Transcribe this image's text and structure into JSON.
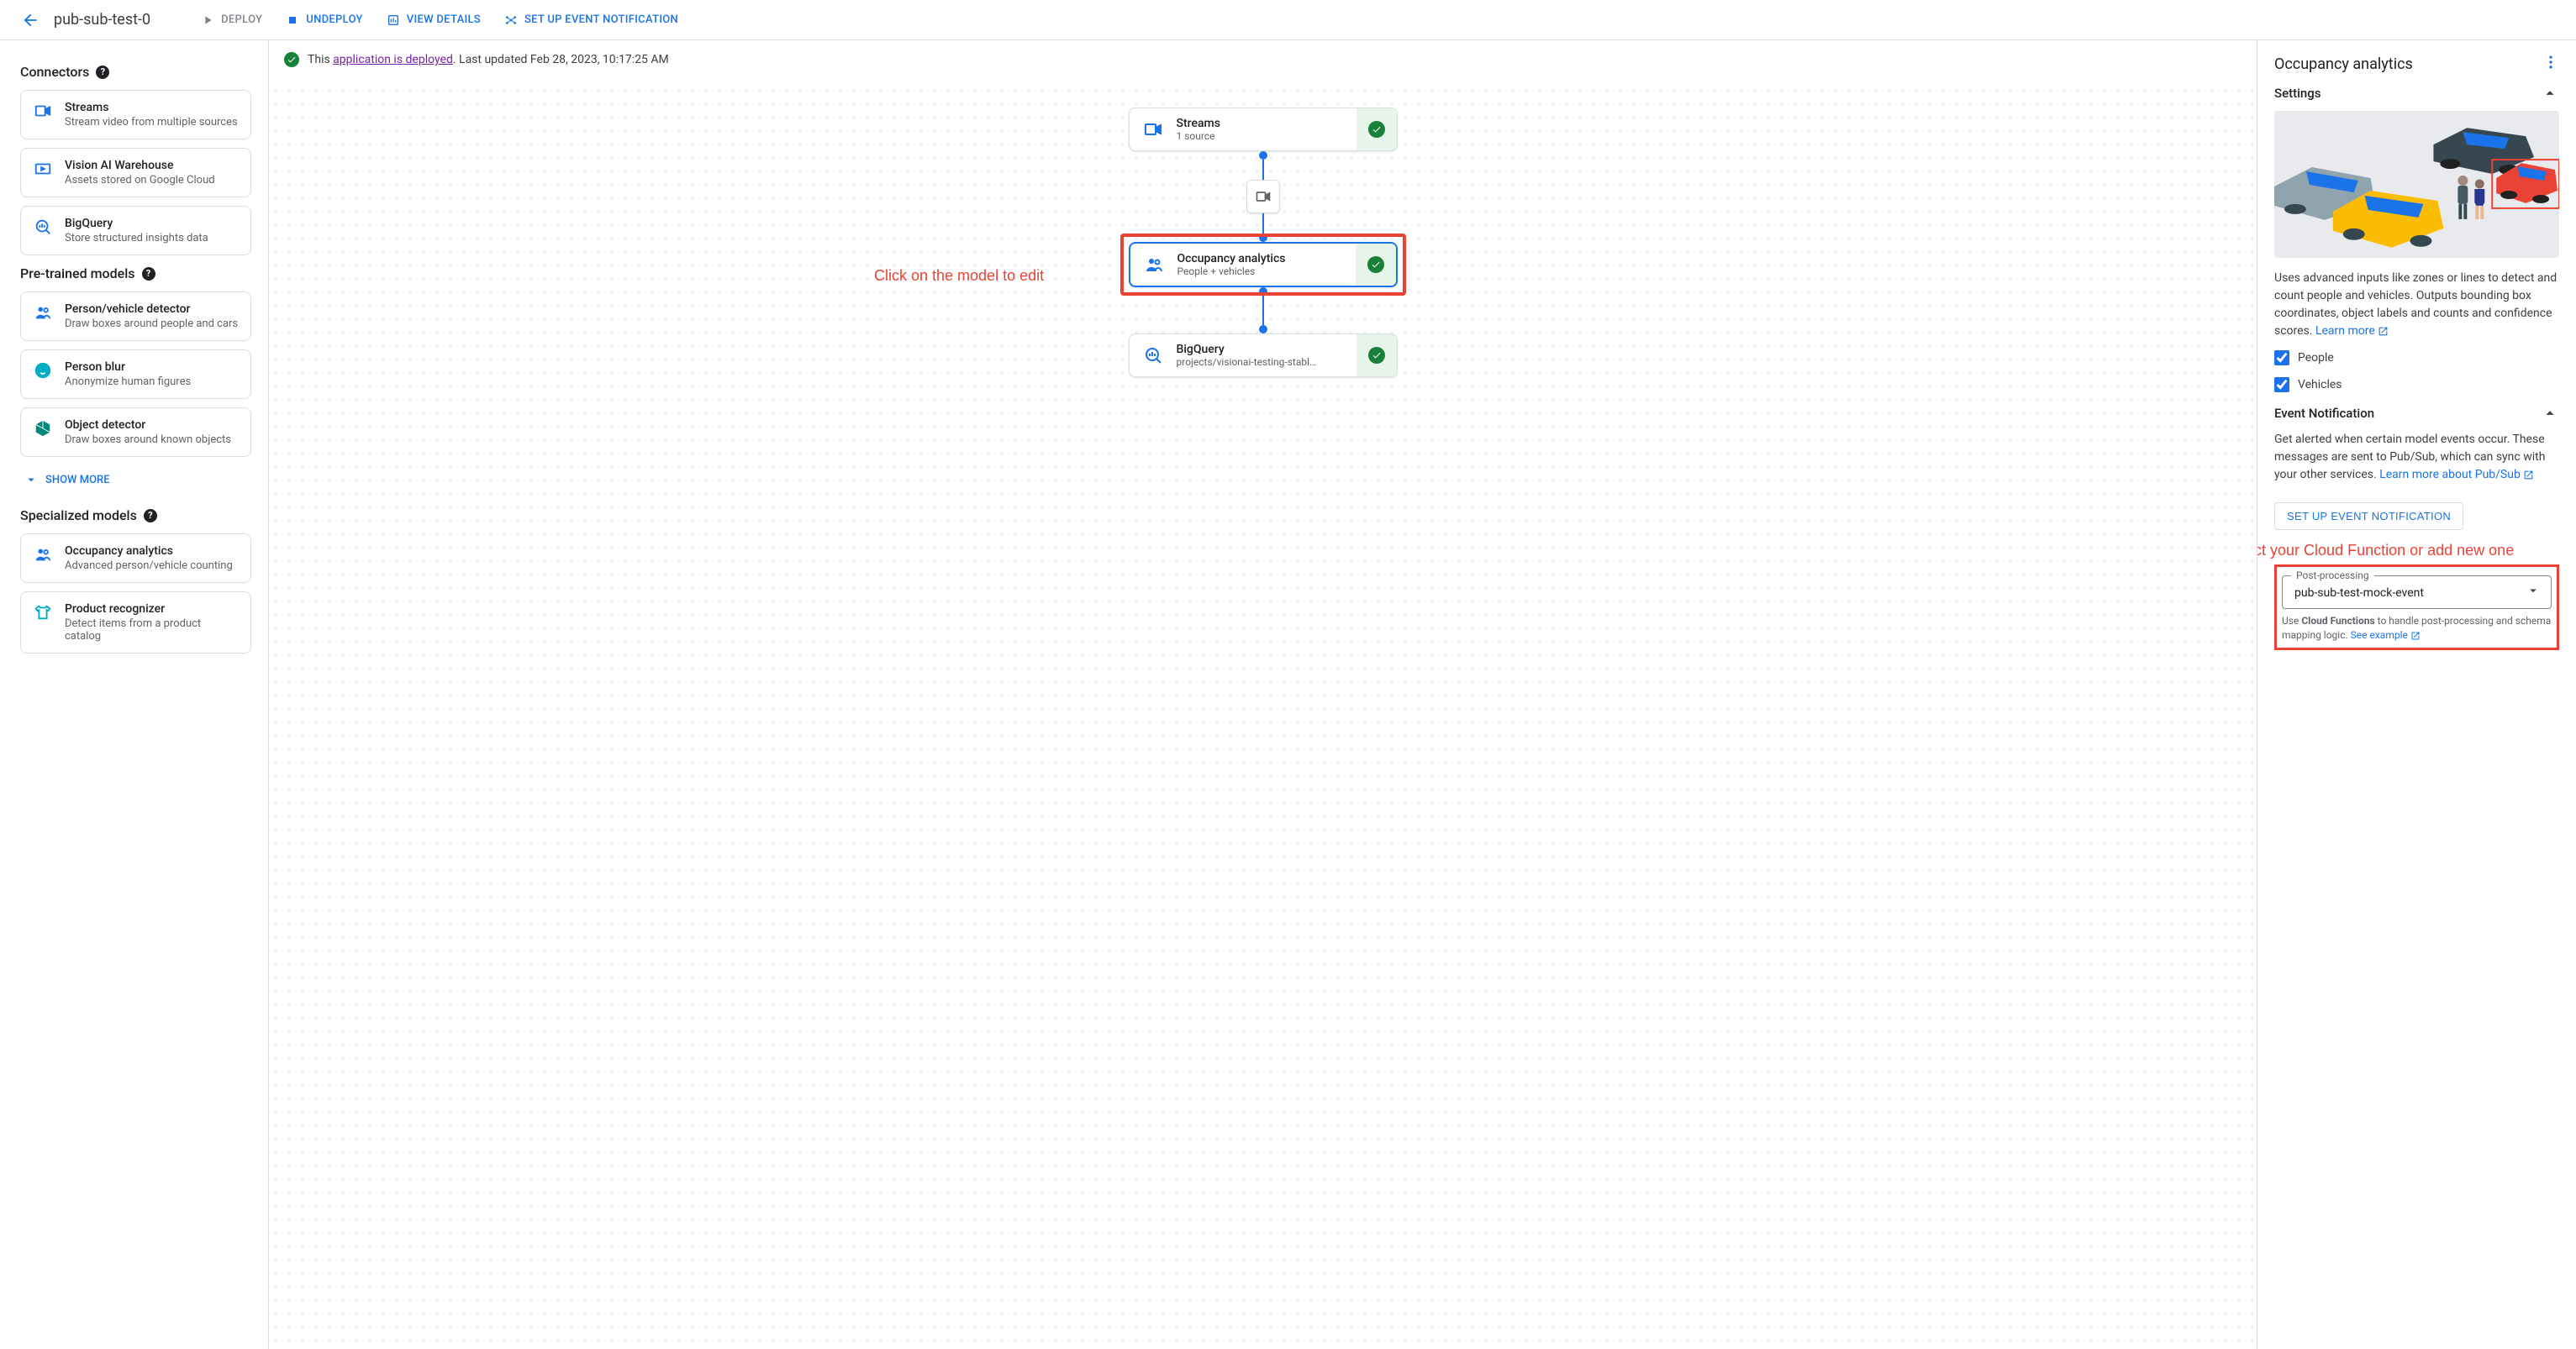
{
  "header": {
    "app_title": "pub-sub-test-0",
    "deploy": "DEPLOY",
    "undeploy": "UNDEPLOY",
    "view_details": "VIEW DETAILS",
    "setup_event": "SET UP EVENT NOTIFICATION"
  },
  "status": {
    "prefix": "This ",
    "link": "application is deployed",
    "suffix": ". Last updated Feb 28, 2023, 10:17:25 AM"
  },
  "sidebar": {
    "sections": {
      "connectors": {
        "title": "Connectors",
        "items": [
          {
            "title": "Streams",
            "desc": "Stream video from multiple sources"
          },
          {
            "title": "Vision AI Warehouse",
            "desc": "Assets stored on Google Cloud"
          },
          {
            "title": "BigQuery",
            "desc": "Store structured insights data"
          }
        ]
      },
      "pretrained": {
        "title": "Pre-trained models",
        "items": [
          {
            "title": "Person/vehicle detector",
            "desc": "Draw boxes around people and cars"
          },
          {
            "title": "Person blur",
            "desc": "Anonymize human figures"
          },
          {
            "title": "Object detector",
            "desc": "Draw boxes around known objects"
          }
        ],
        "show_more": "SHOW MORE"
      },
      "specialized": {
        "title": "Specialized models",
        "items": [
          {
            "title": "Occupancy analytics",
            "desc": "Advanced person/vehicle counting"
          },
          {
            "title": "Product recognizer",
            "desc": "Detect items from a product catalog"
          }
        ]
      }
    }
  },
  "canvas": {
    "annotation1": "Click on the model to edit",
    "nodes": {
      "streams": {
        "title": "Streams",
        "sub": "1 source"
      },
      "occupancy": {
        "title": "Occupancy analytics",
        "sub": "People + vehicles"
      },
      "bigquery": {
        "title": "BigQuery",
        "sub": "projects/visionai-testing-stabl…"
      }
    }
  },
  "rpanel": {
    "title": "Occupancy analytics",
    "settings_label": "Settings",
    "description": "Uses advanced inputs like zones or lines to detect and count people and vehicles. Outputs bounding box coordinates, object labels and counts and confidence scores. ",
    "learn_more": "Learn more",
    "cb_people": "People",
    "cb_vehicles": "Vehicles",
    "event_section": "Event Notification",
    "event_desc": "Get alerted when certain model events occur. These messages are sent to Pub/Sub, which can sync with your other services. ",
    "event_link": "Learn more about Pub/Sub",
    "setup_btn": "SET UP EVENT NOTIFICATION",
    "annotation2": "Select your Cloud Function or add new one",
    "pp_label": "Post-processing",
    "pp_value": "pub-sub-test-mock-event",
    "pp_helper_pre": "Use ",
    "pp_helper_bold": "Cloud Functions",
    "pp_helper_post": " to handle post-processing and schema mapping logic. ",
    "pp_example": "See example"
  }
}
